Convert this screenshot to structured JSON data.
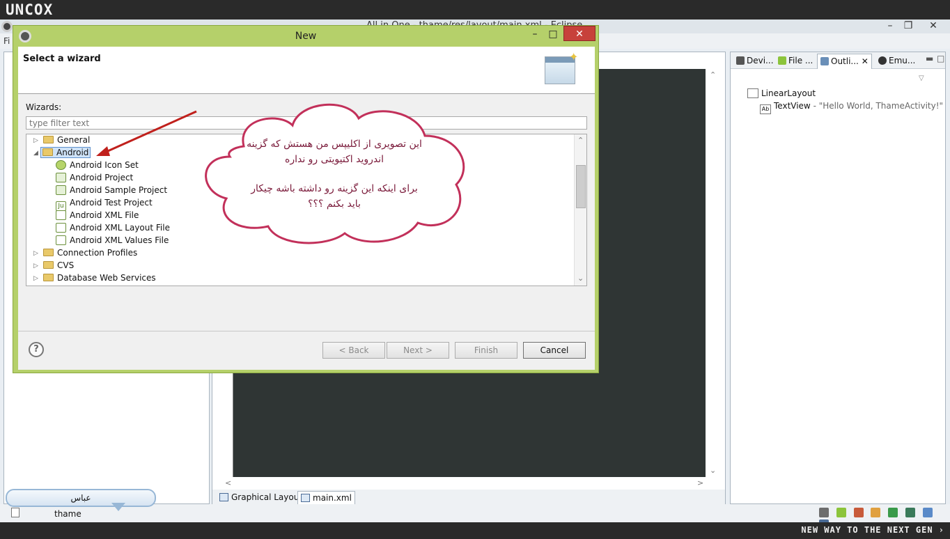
{
  "brand": "UNCOX",
  "tagline": "NEW WAY TO THE NEXT GEN ›",
  "eclipse": {
    "title": "All in One - thame/res/layout/main.xml - Eclipse",
    "menu_first": "Fi",
    "window_controls": [
      "–",
      "❐",
      "✕"
    ]
  },
  "editor": {
    "tabs": [
      "Graphical Layout",
      "main.xml"
    ]
  },
  "right_panel": {
    "tabs": [
      "Devi...",
      "File ...",
      "Outli...",
      "Emu..."
    ],
    "active_tab": "Outli...",
    "outline": [
      {
        "label": "LinearLayout",
        "detail": ""
      },
      {
        "label": "TextView",
        "detail": " - \"Hello World, ThameActivity!\""
      }
    ]
  },
  "status": {
    "text": "thame"
  },
  "name_bubble": "عباس",
  "dialog": {
    "title": "New",
    "heading": "Select a wizard",
    "wizards_label": "Wizards:",
    "filter_placeholder": "type filter text",
    "tree": [
      {
        "label": "General",
        "level": 0,
        "type": "folder",
        "expanded": false
      },
      {
        "label": "Android",
        "level": 0,
        "type": "folder",
        "expanded": true,
        "selected": true
      },
      {
        "label": "Android Icon Set",
        "level": 1,
        "type": "item"
      },
      {
        "label": "Android Project",
        "level": 1,
        "type": "item"
      },
      {
        "label": "Android Sample Project",
        "level": 1,
        "type": "item"
      },
      {
        "label": "Android Test Project",
        "level": 1,
        "type": "item"
      },
      {
        "label": "Android XML File",
        "level": 1,
        "type": "item"
      },
      {
        "label": "Android XML Layout File",
        "level": 1,
        "type": "item"
      },
      {
        "label": "Android XML Values File",
        "level": 1,
        "type": "item"
      },
      {
        "label": "Connection Profiles",
        "level": 0,
        "type": "folder",
        "expanded": false
      },
      {
        "label": "CVS",
        "level": 0,
        "type": "folder",
        "expanded": false
      },
      {
        "label": "Database Web Services",
        "level": 0,
        "type": "folder",
        "expanded": false
      }
    ],
    "buttons": {
      "help": "?",
      "back": "< Back",
      "next": "Next >",
      "finish": "Finish",
      "cancel": "Cancel"
    }
  },
  "annotation": {
    "line1": "این تصویری از اکلیپس من هستش که گزینه",
    "line2": "اندروید اکتیویتی رو نداره",
    "line3": "برای اینکه این گزینه رو داشته باشه چیکار",
    "line4": "باید بکنم ؟؟؟"
  },
  "colors": {
    "dialog_frame": "#b5d06a",
    "close_button": "#c7413b",
    "annotation_border": "#c2305a",
    "annotation_text": "#7a1a3a",
    "arrow": "#c0201c"
  }
}
